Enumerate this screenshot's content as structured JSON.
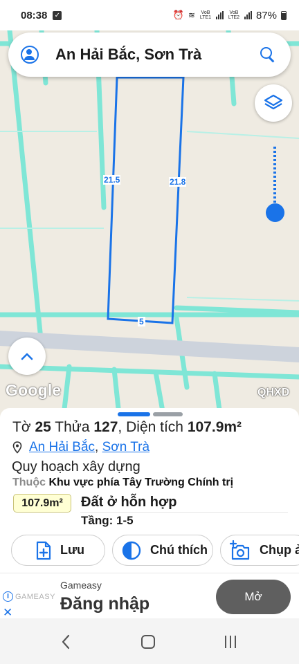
{
  "status_bar": {
    "time": "08:38",
    "network_label_1": "VoB LTE1",
    "network_label_2": "VoB LTE2",
    "battery": "87%"
  },
  "search": {
    "query": "An Hải Bắc, Sơn Trà"
  },
  "map": {
    "edge_labels": {
      "left": "21.5",
      "right": "21.8",
      "bottom": "5"
    },
    "logo": "Google",
    "overlay_tag": "QHXD",
    "zoom_level": 0.76,
    "colors": {
      "parcel_outline": "#1a73e8",
      "plan_lines": "#6fe0d0",
      "road": "#cfd5de"
    }
  },
  "parcel": {
    "sheet_label": "Tờ",
    "sheet_no": "25",
    "plot_label": "Thửa",
    "plot_no": "127",
    "area_label": "Diện tích",
    "area": "107.9m²",
    "ward": "An Hải Bắc",
    "district": "Sơn Trà"
  },
  "planning": {
    "title": "Quy hoạch xây dựng",
    "belongs_label": "Thuộc",
    "zone": "Khu vực phía Tây Trường Chính trị",
    "area_badge": "107.9m²",
    "land_use": "Đất ở hỗn hợp",
    "floors": "Tầng: 1-5"
  },
  "actions": {
    "save": "Lưu",
    "legend": "Chú thích",
    "photo": "Chụp ả"
  },
  "ad": {
    "brand": "GAMEASY",
    "sponsor": "Gameasy",
    "headline": "Đăng nhập",
    "cta": "Mở"
  }
}
